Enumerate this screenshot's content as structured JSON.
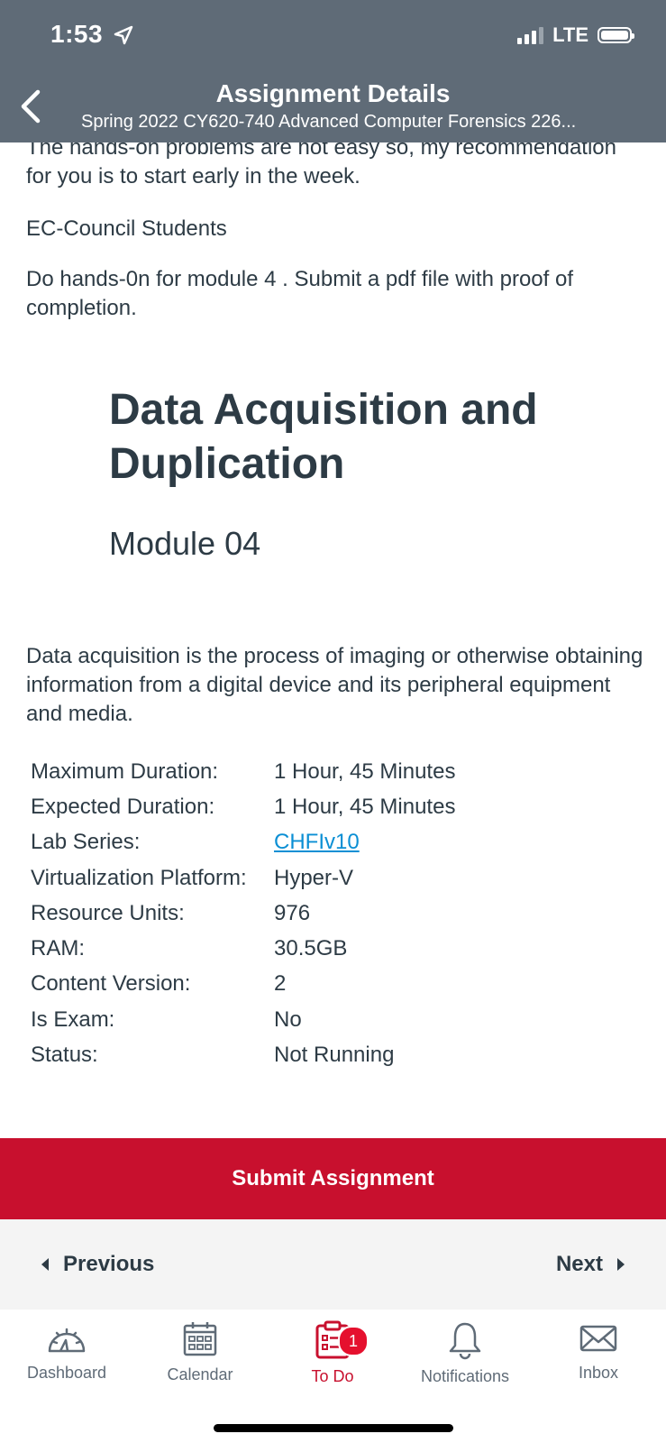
{
  "status_bar": {
    "time": "1:53",
    "network": "LTE"
  },
  "header": {
    "title": "Assignment Details",
    "subtitle": "Spring 2022 CY620-740 Advanced Computer Forensics 226..."
  },
  "body": {
    "intro": "The hands-on problems are not easy so, my recommendation for you is to start early in the week.",
    "group": "EC-Council Students",
    "instruction": "Do hands-0n for module 4 . Submit a pdf file with proof of completion.",
    "module_title": "Data Acquisition and Duplication",
    "module_number": "Module 04",
    "description": "Data acquisition is the process of imaging or otherwise obtaining information from a digital device and its peripheral equipment and media."
  },
  "details": [
    {
      "label": "Maximum Duration:",
      "value": "1 Hour, 45 Minutes"
    },
    {
      "label": "Expected Duration:",
      "value": "1 Hour, 45 Minutes"
    },
    {
      "label": "Lab Series:",
      "value": "CHFIv10"
    },
    {
      "label": "Virtualization Platform:",
      "value": "Hyper-V"
    },
    {
      "label": "Resource Units:",
      "value": "976"
    },
    {
      "label": "RAM:",
      "value": "30.5GB"
    },
    {
      "label": "Content Version:",
      "value": "2"
    },
    {
      "label": "Is Exam:",
      "value": "No"
    },
    {
      "label": "Status:",
      "value": "Not Running"
    }
  ],
  "actions": {
    "submit": "Submit Assignment",
    "previous": "Previous",
    "next": "Next"
  },
  "tabs": [
    {
      "label": "Dashboard",
      "icon": "dashboard-icon"
    },
    {
      "label": "Calendar",
      "icon": "calendar-icon"
    },
    {
      "label": "To Do",
      "icon": "todo-icon",
      "badge": "1",
      "active": true
    },
    {
      "label": "Notifications",
      "icon": "bell-icon"
    },
    {
      "label": "Inbox",
      "icon": "mail-icon"
    }
  ],
  "colors": {
    "header": "#5f6b77",
    "accent": "#c8102e",
    "link": "#0b8fd4",
    "text": "#2d3b45"
  }
}
